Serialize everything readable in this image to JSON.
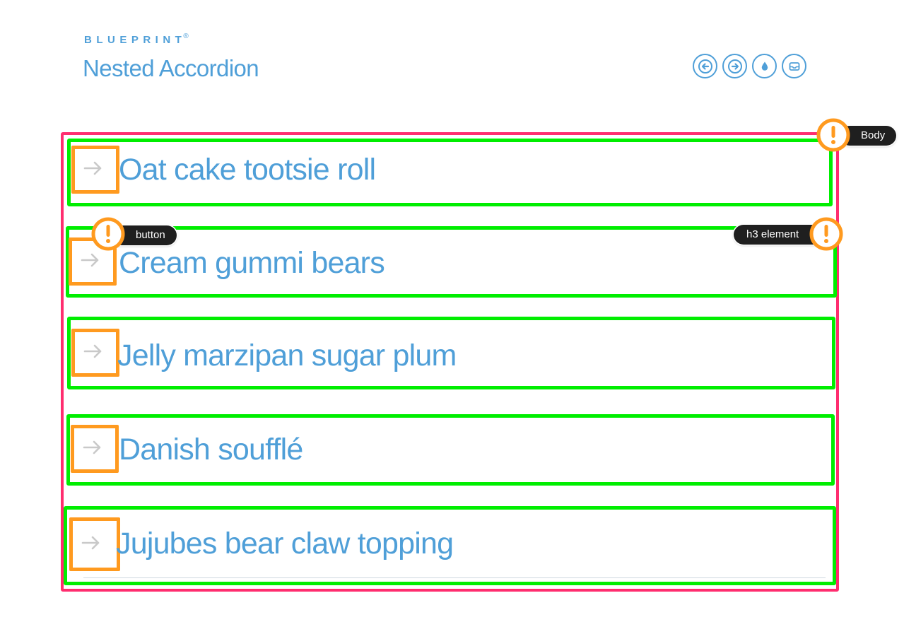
{
  "header": {
    "brand": "BLUEPRINT",
    "brand_mark": "®",
    "title": "Nested Accordion"
  },
  "nav_buttons": [
    {
      "icon": "arrow-left-icon"
    },
    {
      "icon": "arrow-right-icon"
    },
    {
      "icon": "droplet-icon"
    },
    {
      "icon": "inbox-icon"
    }
  ],
  "accordion": {
    "items": [
      {
        "label": "Oat cake tootsie roll"
      },
      {
        "label": "Cream gummi bears"
      },
      {
        "label": "Jelly marzipan sugar plum"
      },
      {
        "label": "Danish soufflé"
      },
      {
        "label": "Jujubes bear claw topping"
      }
    ]
  },
  "annotations": {
    "body": "Body",
    "button": "button",
    "h3": "h3 element"
  },
  "colors": {
    "accent": "#4f9fd8",
    "body_outline": "#ff2d6f",
    "item_outline": "#00ee00",
    "button_outline": "#ff9a1f",
    "arrow": "#c9c9c9",
    "tag_bg": "#1f1f1f"
  }
}
